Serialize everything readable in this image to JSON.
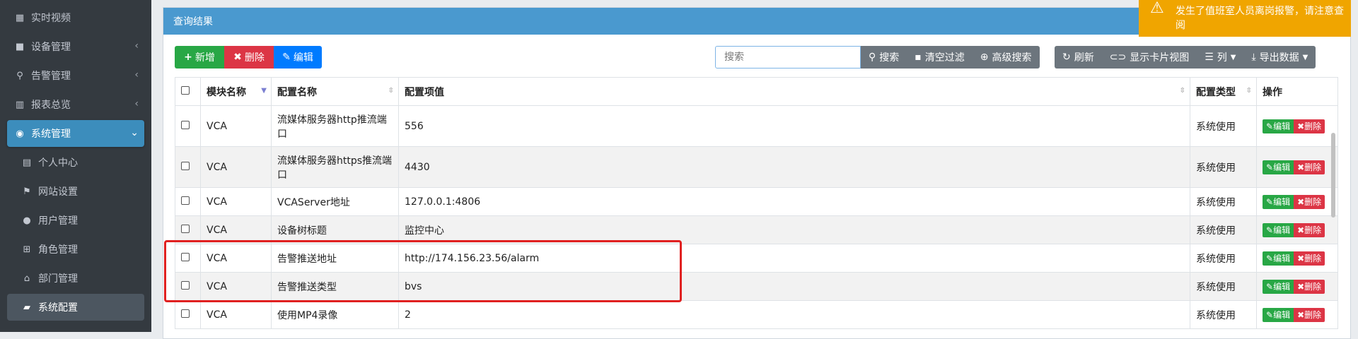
{
  "sidebar": {
    "items": [
      {
        "label": "实时视频",
        "icon": "film-icon",
        "glyph": "▦",
        "chevron": ""
      },
      {
        "label": "设备管理",
        "icon": "video-camera-icon",
        "glyph": "■",
        "chevron": "‹"
      },
      {
        "label": "告警管理",
        "icon": "search-icon",
        "glyph": "⚲",
        "chevron": "‹"
      },
      {
        "label": "报表总览",
        "icon": "bar-chart-icon",
        "glyph": "▥",
        "chevron": "‹"
      },
      {
        "label": "系统管理",
        "icon": "user-circle-icon",
        "glyph": "◉",
        "chevron": "⌄"
      },
      {
        "label": "个人中心",
        "icon": "briefcase-icon",
        "glyph": "▤",
        "chevron": ""
      },
      {
        "label": "网站设置",
        "icon": "flag-icon",
        "glyph": "⚑",
        "chevron": ""
      },
      {
        "label": "用户管理",
        "icon": "user-icon",
        "glyph": "●",
        "chevron": ""
      },
      {
        "label": "角色管理",
        "icon": "sitemap-icon",
        "glyph": "⊞",
        "chevron": ""
      },
      {
        "label": "部门管理",
        "icon": "institution-icon",
        "glyph": "⌂",
        "chevron": ""
      },
      {
        "label": "系统配置",
        "icon": "book-icon",
        "glyph": "▰",
        "chevron": ""
      }
    ]
  },
  "card": {
    "title": "查询结果"
  },
  "toolbar": {
    "add_label": "新增",
    "delete_label": "删除",
    "edit_label": "编辑",
    "search_placeholder": "搜索",
    "search_label": "搜索",
    "clear_filter_label": "清空过滤",
    "advanced_search_label": "高级搜索",
    "refresh_label": "刷新",
    "card_view_label": "显示卡片视图",
    "columns_label": "列",
    "export_label": "导出数据"
  },
  "table": {
    "headers": {
      "module": "模块名称",
      "name": "配置名称",
      "value": "配置项值",
      "type": "配置类型",
      "ops": "操作"
    },
    "rows": [
      {
        "module": "VCA",
        "name": "流媒体服务器http推流端口",
        "value": "556",
        "type": "系统使用"
      },
      {
        "module": "VCA",
        "name": "流媒体服务器https推流端口",
        "value": "4430",
        "type": "系统使用"
      },
      {
        "module": "VCA",
        "name": "VCAServer地址",
        "value": "127.0.0.1:4806",
        "type": "系统使用"
      },
      {
        "module": "VCA",
        "name": "设备树标题",
        "value": "监控中心",
        "type": "系统使用"
      },
      {
        "module": "VCA",
        "name": "告警推送地址",
        "value": "http://174.156.23.56/alarm",
        "type": "系统使用"
      },
      {
        "module": "VCA",
        "name": "告警推送类型",
        "value": "bvs",
        "type": "系统使用"
      },
      {
        "module": "VCA",
        "name": "使用MP4录像",
        "value": "2",
        "type": "系统使用"
      }
    ],
    "row_edit_label": "编辑",
    "row_delete_label": "删除"
  },
  "toast": {
    "message": "发生了值班室人员离岗报警，请注意查阅"
  },
  "colors": {
    "accent": "#3c8dbc",
    "header": "#4a99cf",
    "success": "#28a745",
    "danger": "#dc3545",
    "primary": "#007bff",
    "warning": "#f0a500"
  }
}
